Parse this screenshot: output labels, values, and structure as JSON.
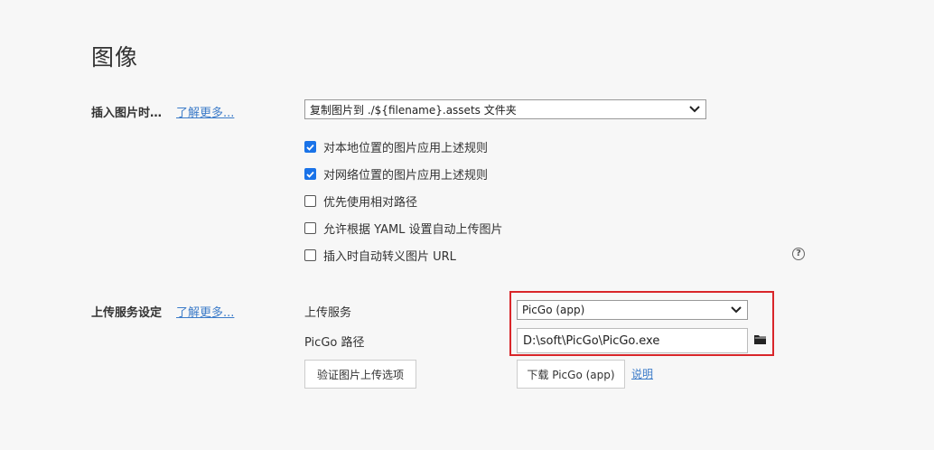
{
  "page": {
    "title": "图像"
  },
  "insert_image": {
    "label": "插入图片时…",
    "learn_more": "了解更多...",
    "select_value": "复制图片到 ./${filename}.assets 文件夹",
    "options": [
      {
        "label": "对本地位置的图片应用上述规则",
        "checked": true
      },
      {
        "label": "对网络位置的图片应用上述规则",
        "checked": true
      },
      {
        "label": "优先使用相对路径",
        "checked": false
      },
      {
        "label": "允许根据 YAML 设置自动上传图片",
        "checked": false
      },
      {
        "label": "插入时自动转义图片 URL",
        "checked": false
      }
    ],
    "help_glyph": "?"
  },
  "upload": {
    "label": "上传服务设定",
    "learn_more": "了解更多...",
    "service_label": "上传服务",
    "service_value": "PicGo (app)",
    "path_label": "PicGo 路径",
    "path_value": "D:\\soft\\PicGo\\PicGo.exe",
    "verify_button": "验证图片上传选项",
    "download_button": "下载 PicGo (app)",
    "help_link": "说明"
  },
  "colors": {
    "accent": "#1a73e8",
    "link": "#3d7cc9",
    "highlight": "#d9262a"
  }
}
